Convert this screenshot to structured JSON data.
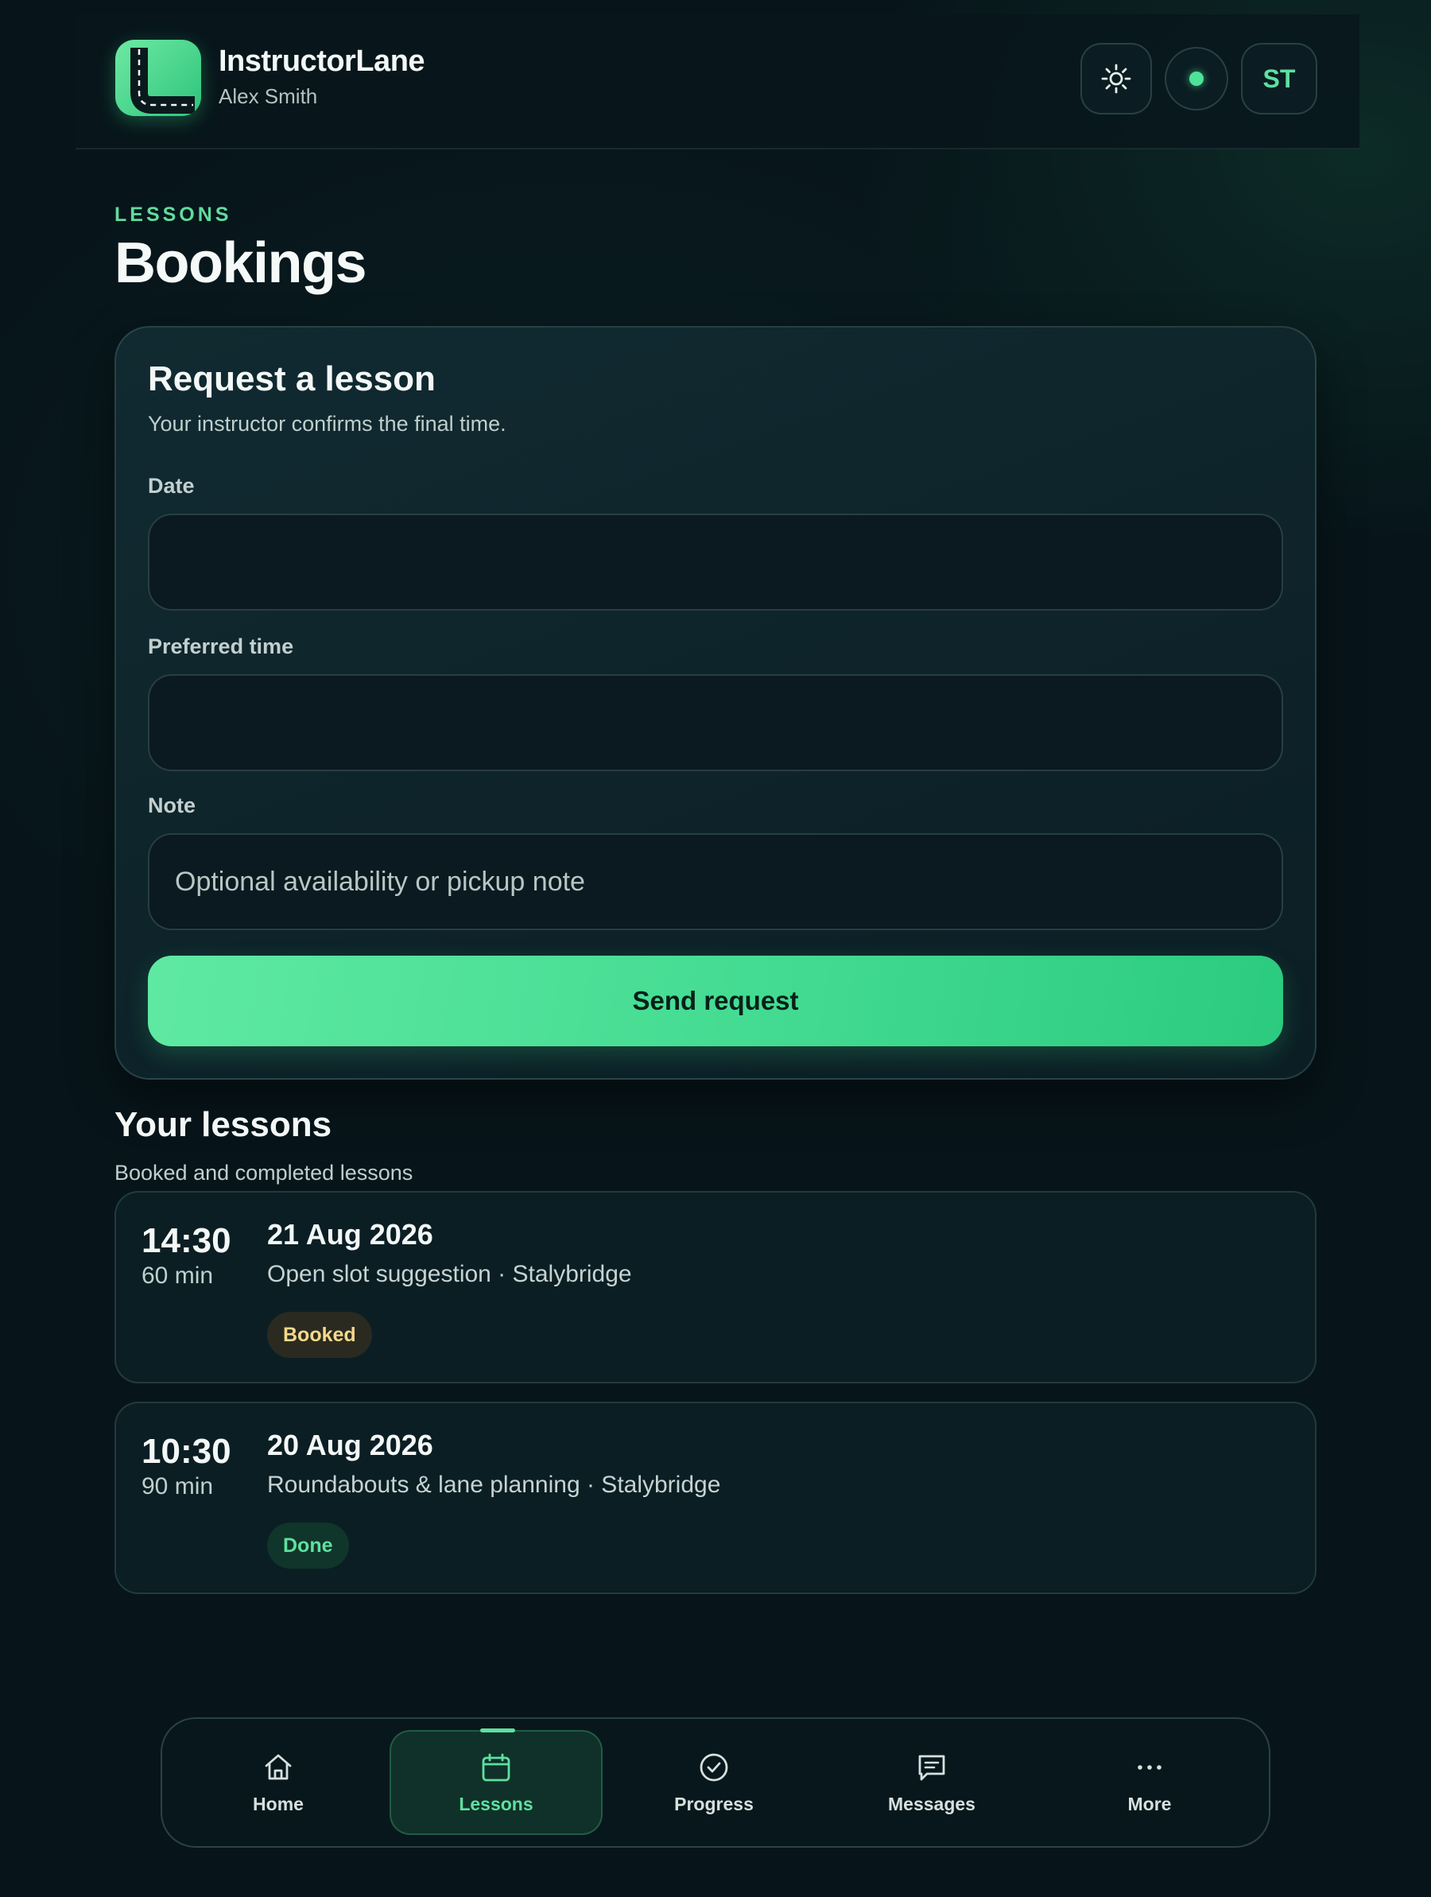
{
  "header": {
    "app_name": "InstructorLane",
    "user_name": "Alex Smith",
    "avatar_initials": "ST",
    "icons": [
      "road-logo-icon",
      "sun-icon",
      "status-dot-icon"
    ]
  },
  "page": {
    "eyebrow": "LESSONS",
    "title": "Bookings"
  },
  "request_form": {
    "title": "Request a lesson",
    "subtitle": "Your instructor confirms the final time.",
    "date_label": "Date",
    "date_value": "",
    "time_label": "Preferred time",
    "time_value": "",
    "note_label": "Note",
    "note_value": "",
    "note_placeholder": "Optional availability or pickup note",
    "submit_label": "Send request"
  },
  "lessons": {
    "title": "Your lessons",
    "subtitle": "Booked and completed lessons",
    "items": [
      {
        "time": "14:30",
        "duration": "60 min",
        "date": "21 Aug 2026",
        "description": "Open slot suggestion · Stalybridge",
        "status": "Booked"
      },
      {
        "time": "10:30",
        "duration": "90 min",
        "date": "20 Aug 2026",
        "description": "Roundabouts & lane planning · Stalybridge",
        "status": "Done"
      }
    ]
  },
  "nav": {
    "items": [
      {
        "label": "Home",
        "icon": "home-icon"
      },
      {
        "label": "Lessons",
        "icon": "calendar-icon",
        "active": true
      },
      {
        "label": "Progress",
        "icon": "check-circle-icon"
      },
      {
        "label": "Messages",
        "icon": "message-icon"
      },
      {
        "label": "More",
        "icon": "more-dots-icon"
      }
    ]
  },
  "colors": {
    "accent": "#5fe0a0",
    "background": "#07151a",
    "card": "#0b1e24",
    "booked_badge_text": "#f5d98a",
    "done_badge_text": "#5fe0a0"
  }
}
